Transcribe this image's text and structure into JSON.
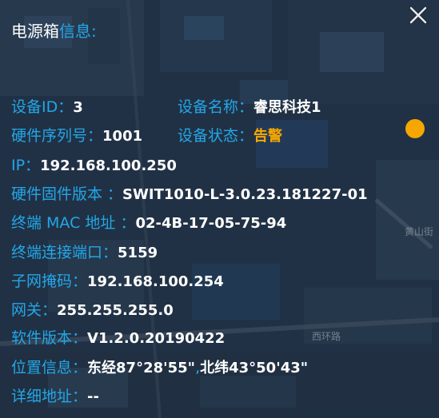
{
  "dialog": {
    "title_part1": "电源箱",
    "title_part2": "信息:",
    "close_icon": "close-icon"
  },
  "fields": {
    "device_id": {
      "label": "设备ID：",
      "value": "3"
    },
    "device_name": {
      "label": "设备名称：",
      "value": "睿思科技1"
    },
    "serial": {
      "label": "硬件序列号：",
      "value": "1001"
    },
    "status": {
      "label": "设备状态：",
      "value": "告警"
    },
    "ip": {
      "label": "IP：",
      "value": "192.168.100.250"
    },
    "firmware": {
      "label": "硬件固件版本 ：",
      "value": "SWIT1010-L-3.0.23.181227-01"
    },
    "mac": {
      "label": "终端 MAC 地址 ：",
      "value": "02-4B-17-05-75-94"
    },
    "port": {
      "label": "终端连接端口：",
      "value": "5159"
    },
    "subnet": {
      "label": "子网掩码：",
      "value": "192.168.100.254"
    },
    "gateway": {
      "label": "网关：",
      "value": "255.255.255.0"
    },
    "software": {
      "label": "软件版本：",
      "value": "V1.2.0.20190422"
    },
    "location": {
      "label": "位置信息：",
      "value_lon": "东经87°28'55\"",
      "separator": ",",
      "value_lat": "北纬43°50'43\""
    },
    "address": {
      "label": "详细地址：",
      "value": "--"
    }
  },
  "map_labels": {
    "road": "西环路",
    "area": "黄山街"
  },
  "colors": {
    "label": "#22a7e8",
    "value": "#ffffff",
    "alarm": "#f5a700",
    "status_dot": "#f5a700"
  }
}
